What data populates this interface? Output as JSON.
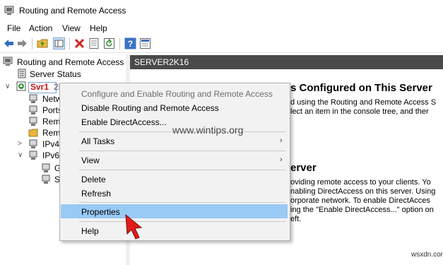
{
  "window": {
    "title": "Routing and Remote Access"
  },
  "menu": [
    "File",
    "Action",
    "View",
    "Help"
  ],
  "toolbar": {
    "icons": [
      "back-icon",
      "forward-icon",
      "up-folder-icon",
      "show-hide-tree-icon",
      "delete-icon",
      "properties-icon",
      "refresh-icon",
      "help-icon",
      "console-icon"
    ]
  },
  "tree": {
    "root": "Routing and Remote Access",
    "server_status": "Server Status",
    "server": "Svr1",
    "server_suffix": "2K16",
    "children": [
      "Netw",
      "Ports",
      "Rem",
      "Rem",
      "IPv4",
      "IPv6"
    ],
    "ipv6_children": [
      "G",
      "S"
    ]
  },
  "right": {
    "header": "SERVER2K16",
    "heading1": "s Configured on This Server",
    "line1": "d using the Routing and Remote Access S",
    "line2": "lect an item in the console tree, and ther",
    "heading2": "erver",
    "p1": "oviding remote access to your clients. Yo",
    "p2": "nabling DirectAccess on this server. Using",
    "p3": "orporate network. To enable DirectAcces",
    "p4": "ing the \"Enable DirectAccess...\" option on",
    "p5": "eft."
  },
  "context_menu": {
    "items": [
      "Configure and Enable Routing and Remote Access",
      "Disable Routing and Remote Access",
      "Enable DirectAccess...",
      "All Tasks",
      "View",
      "Delete",
      "Refresh",
      "Properties",
      "Help"
    ],
    "highlighted": "Properties",
    "highlight_color": "#99c9f5"
  },
  "watermark": "www.wintips.org",
  "corner_mark": "wsxdn.com"
}
